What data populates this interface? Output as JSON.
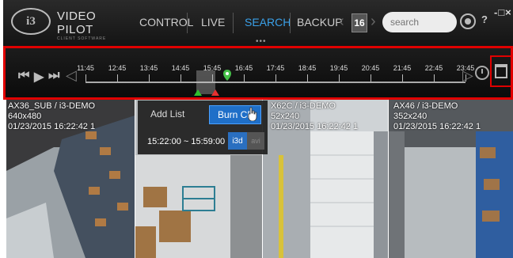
{
  "header": {
    "logo_text": "i3",
    "brand_title": "VIDEO PILOT",
    "brand_subtitle": "CLIENT SOFTWARE",
    "nav": [
      {
        "label": "CONTROL",
        "active": false
      },
      {
        "label": "LIVE",
        "active": false
      },
      {
        "label": "SEARCH",
        "active": true
      },
      {
        "label": "BACKUP",
        "active": false
      }
    ],
    "dots": "•••",
    "page_number": "16",
    "search_placeholder": "search",
    "help_label": "?",
    "window_controls": "-□×"
  },
  "timeline": {
    "times": [
      "11:45",
      "12:45",
      "13:45",
      "14:45",
      "15:45",
      "16:45",
      "17:45",
      "18:45",
      "19:45",
      "20:45",
      "21:45",
      "22:45",
      "23:45"
    ]
  },
  "cameras": [
    {
      "name": "AX36_SUB / i3-DEMO",
      "resolution": "640x480",
      "timestamp": "01/23/2015 16:22:42 1"
    },
    {
      "name": "",
      "resolution": "",
      "timestamp": ""
    },
    {
      "name": "X62C / i3-DEMO",
      "resolution": "52x240",
      "timestamp": "01/23/2015 16:22:42 1"
    },
    {
      "name": "AX46 / i3-DEMO",
      "resolution": "352x240",
      "timestamp": "01/23/2015 16:22:42 1"
    }
  ],
  "popup": {
    "add_list": "Add List",
    "burn_cd": "Burn CD",
    "time_range": "15:22:00 ~ 15:59:00",
    "mode_i3d": "i3d",
    "mode_avi": "avi"
  },
  "colors": {
    "accent": "#3aa0e8",
    "highlight_border": "#e00000",
    "button_blue": "#1f6fc8"
  }
}
